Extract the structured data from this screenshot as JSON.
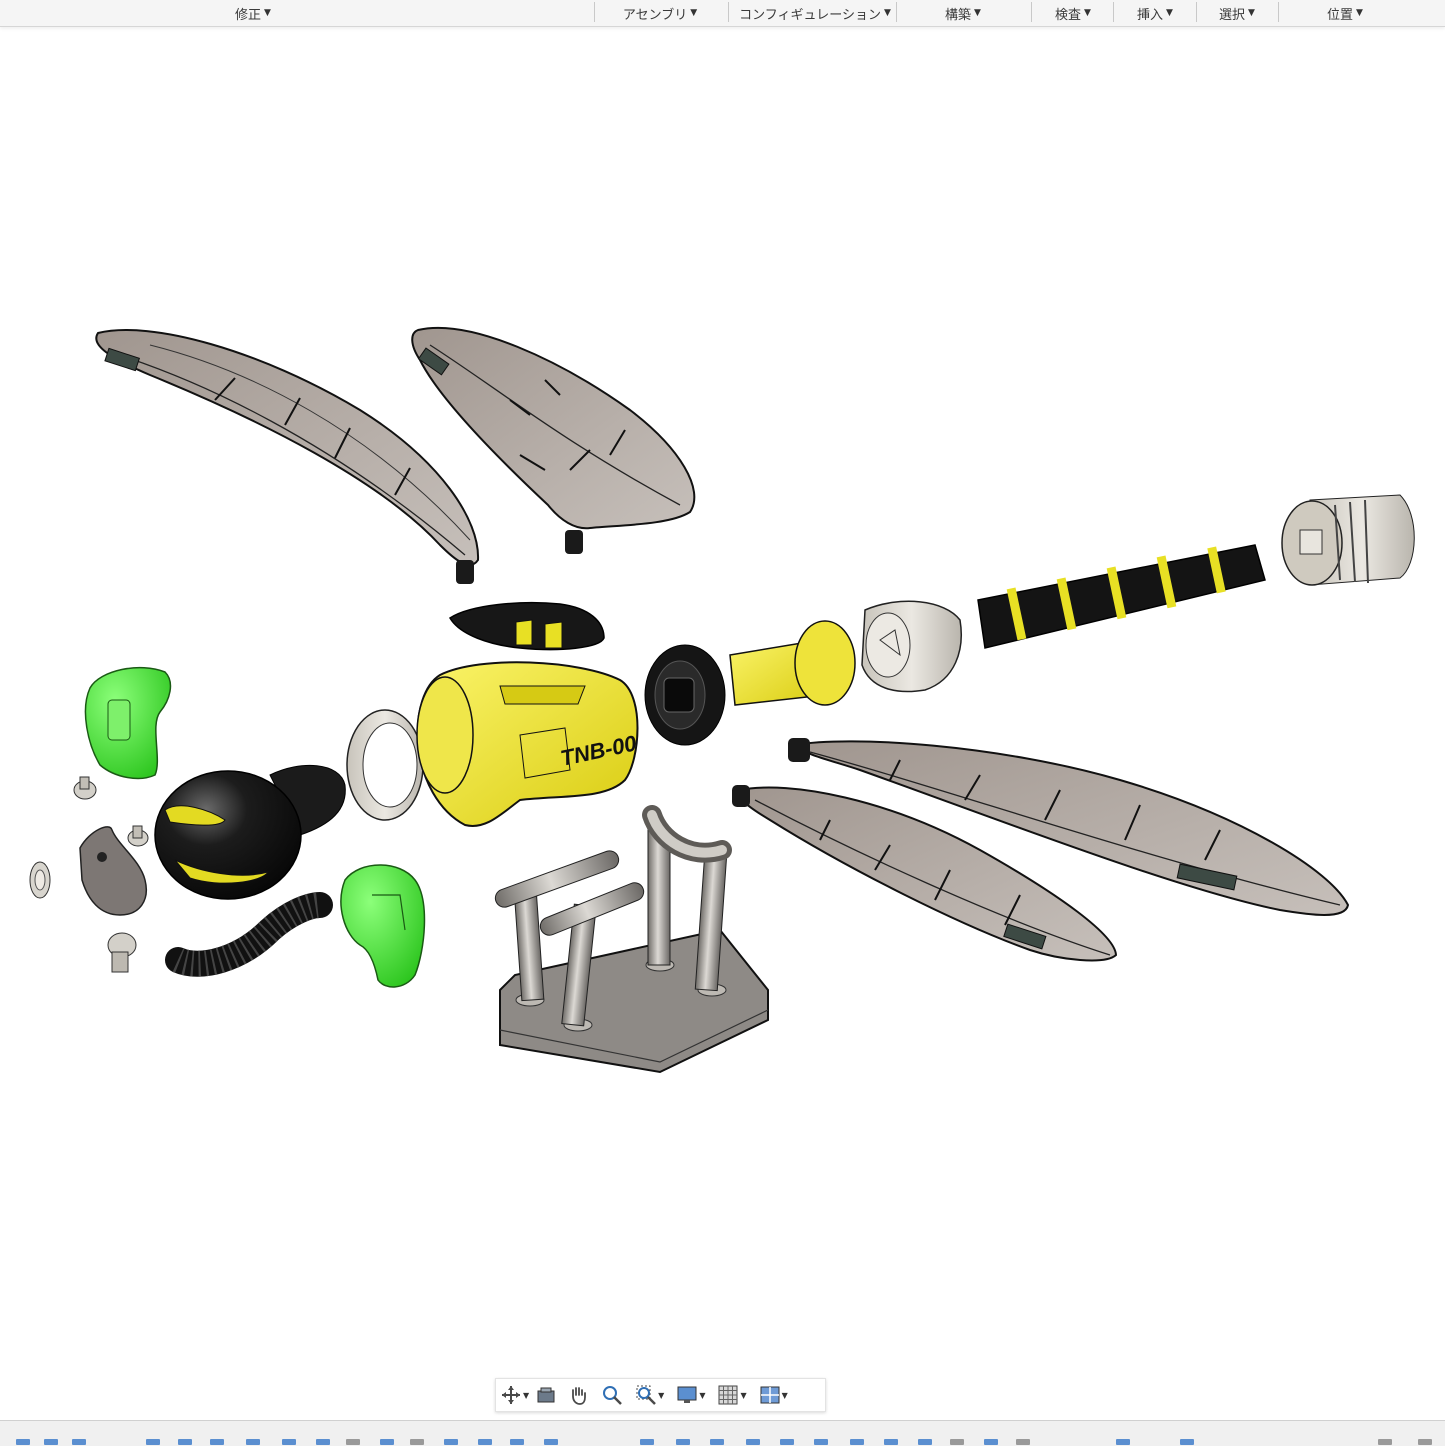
{
  "toolbar": {
    "menus": [
      {
        "label": "修正"
      },
      {
        "label": "アセンブリ"
      },
      {
        "label": "コンフィギュレーション"
      },
      {
        "label": "構築"
      },
      {
        "label": "検査"
      },
      {
        "label": "挿入"
      },
      {
        "label": "選択"
      },
      {
        "label": "位置"
      }
    ]
  },
  "model": {
    "body_label": "TNB-00",
    "colors": {
      "yellow": "#f4ea2a",
      "green": "#3fe03a",
      "black": "#141414",
      "gray": "#d8d4cc",
      "wing": "#9d9189",
      "stand": "#8e8a86"
    }
  },
  "navbar": {
    "tools": [
      "orbit-icon",
      "look-at-icon",
      "pan-icon",
      "zoom-icon",
      "zoom-window-icon",
      "display-settings-icon",
      "grid-settings-icon",
      "viewports-icon"
    ]
  }
}
